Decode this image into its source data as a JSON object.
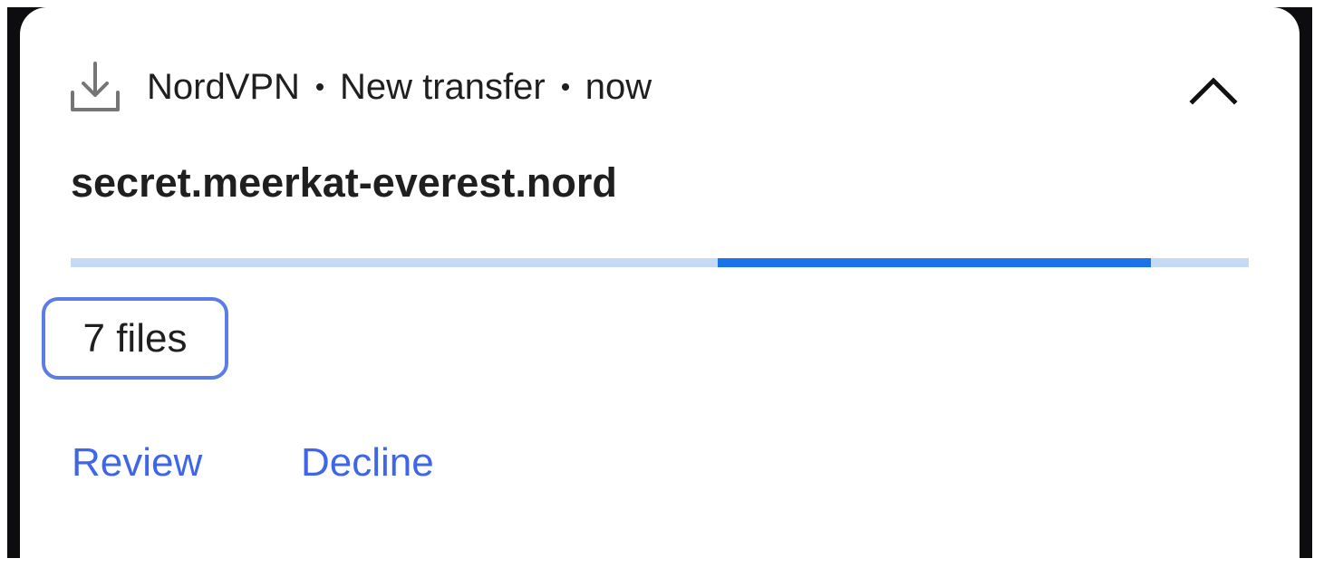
{
  "notification": {
    "app_name": "NordVPN",
    "category": "New transfer",
    "time": "now",
    "title": "secret.meerkat-everest.nord",
    "progress_fraction": 0.55,
    "files_label": "7 files",
    "actions": {
      "review": "Review",
      "decline": "Decline"
    }
  },
  "icons": {
    "app_icon": "download-icon",
    "collapse": "chevron-up-icon"
  },
  "colors": {
    "accent": "#3f66e8",
    "progress_track": "#c6daf6",
    "progress_fill": "#1a73e8",
    "chip_border": "#5a7de6",
    "text": "#1f1f1f"
  }
}
